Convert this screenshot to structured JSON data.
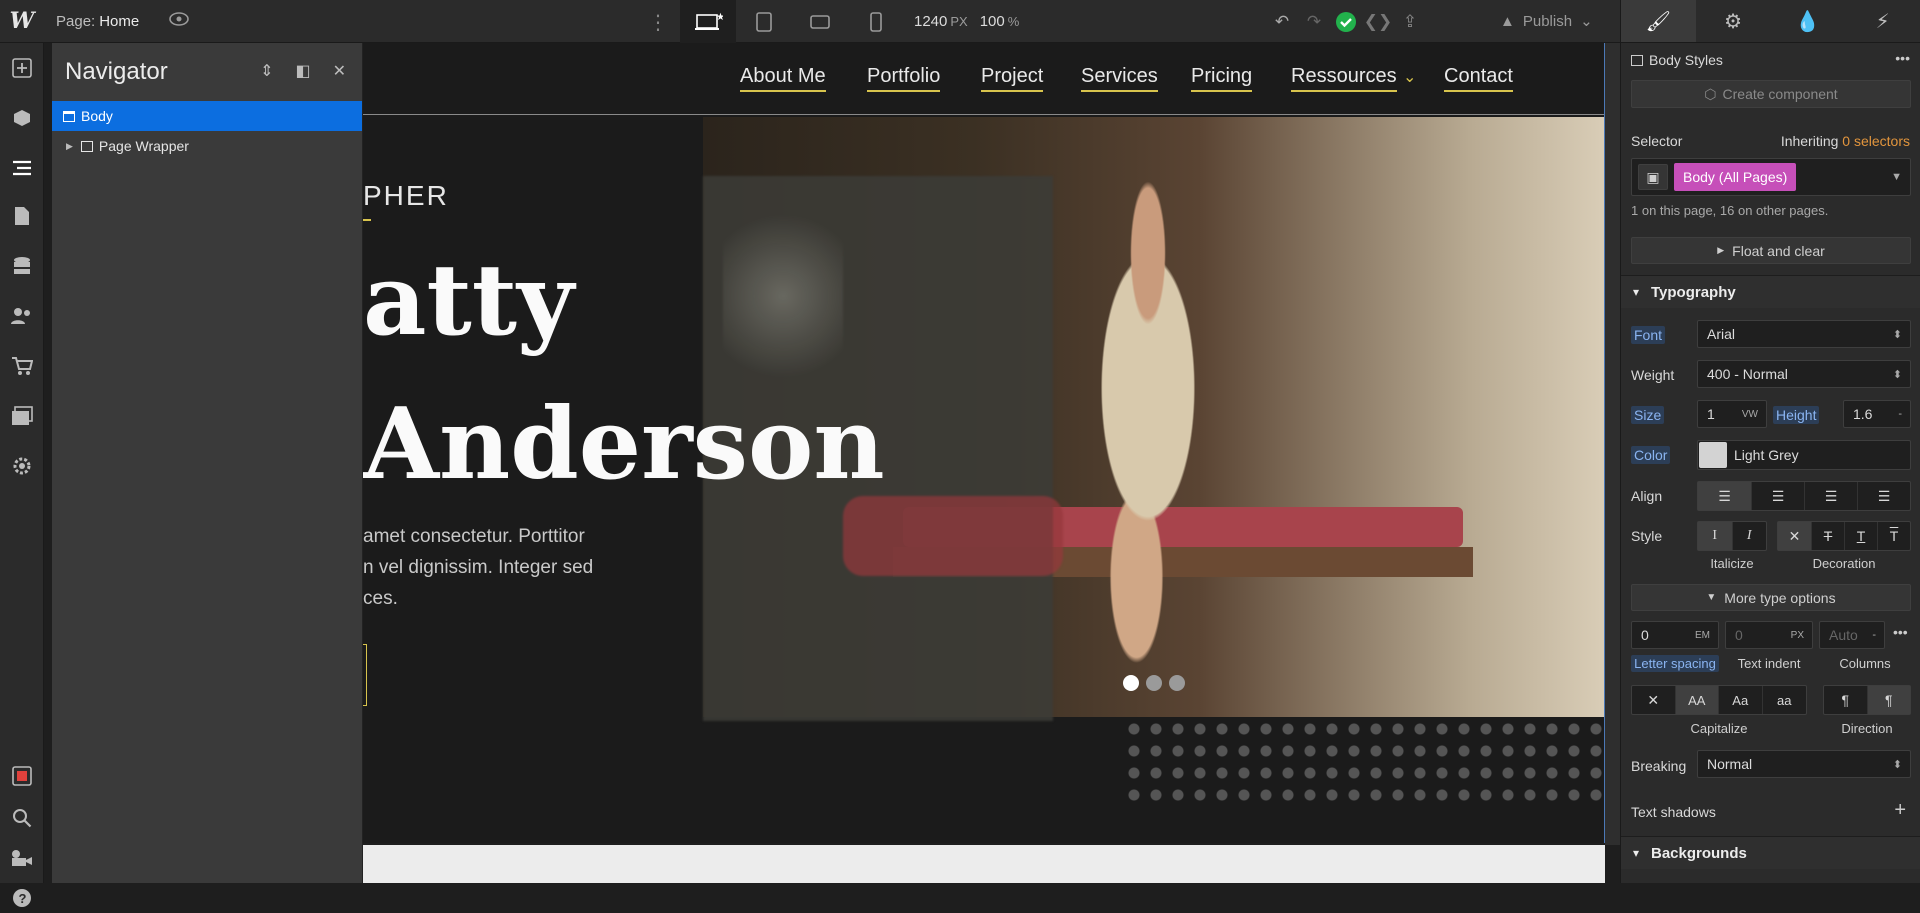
{
  "topbar": {
    "logo": "W",
    "page_label": "Page:",
    "page_name": "Home",
    "width_value": "1240",
    "width_unit": "PX",
    "zoom_value": "100",
    "zoom_unit": "%",
    "publish_label": "Publish"
  },
  "navigator": {
    "title": "Navigator",
    "items": [
      {
        "label": "Body"
      },
      {
        "label": "Page Wrapper"
      }
    ]
  },
  "site": {
    "nav": [
      "About Me",
      "Portfolio",
      "Project",
      "Services",
      "Pricing",
      "Ressources",
      "Contact"
    ],
    "eyebrow": "PHER",
    "headline_1": "atty",
    "headline_2": "Anderson",
    "paragraph_1": "amet consectetur. Porttitor",
    "paragraph_2": "n vel dignissim. Integer sed",
    "paragraph_3": "ces."
  },
  "style_panel": {
    "body_styles": "Body Styles",
    "create_component": "Create component",
    "selector_label": "Selector",
    "inheriting_prefix": "Inheriting",
    "inheriting_count": "0 selectors",
    "selector_chip": "Body (All Pages)",
    "usage_note": "1 on this page, 16 on other pages.",
    "float_clear": "Float and clear",
    "typography": "Typography",
    "font_label": "Font",
    "font_value": "Arial",
    "weight_label": "Weight",
    "weight_value": "400 - Normal",
    "size_label": "Size",
    "size_value": "1",
    "size_unit": "VW",
    "height_label": "Height",
    "height_value": "1.6",
    "height_unit": "-",
    "color_label": "Color",
    "color_value": "Light Grey",
    "color_swatch": "#d3d3d3",
    "align_label": "Align",
    "style_label": "Style",
    "italicize": "Italicize",
    "decoration": "Decoration",
    "more_type": "More type options",
    "letter_spacing_value": "0",
    "letter_spacing_unit": "EM",
    "text_indent_value": "0",
    "text_indent_unit": "PX",
    "columns_value": "Auto",
    "columns_unit": "-",
    "letter_spacing_label": "Letter spacing",
    "text_indent_label": "Text indent",
    "columns_label": "Columns",
    "capitalize": "Capitalize",
    "direction": "Direction",
    "breaking_label": "Breaking",
    "breaking_value": "Normal",
    "text_shadows": "Text shadows",
    "backgrounds": "Backgrounds"
  },
  "colors": {
    "accent_blue": "#0c6ee0",
    "selector_pink": "#c64fb9",
    "nav_underline": "#d8c44d",
    "success_green": "#22b14c"
  }
}
